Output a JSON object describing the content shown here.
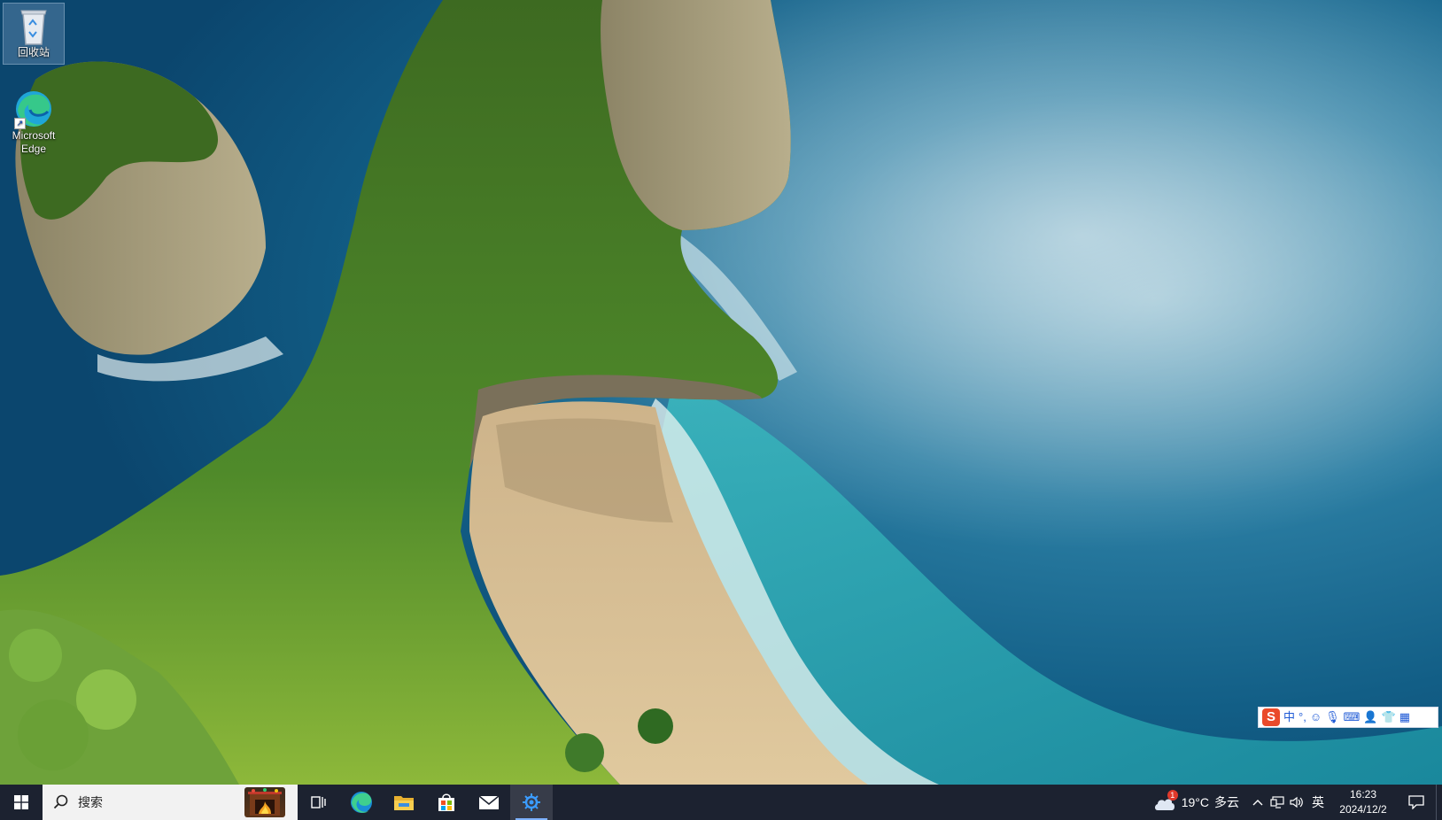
{
  "desktop": {
    "icons": [
      {
        "label": "回收站",
        "icon": "recycle-bin-icon"
      },
      {
        "label": "Microsoft Edge",
        "icon": "edge-icon"
      }
    ]
  },
  "ime_toolbar": {
    "logo": "S",
    "mode": "中",
    "items": [
      "punctuation-icon",
      "emoji-icon",
      "microphone-icon",
      "keyboard-icon",
      "user-icon",
      "skin-icon",
      "toolbox-icon"
    ]
  },
  "taskbar": {
    "search_placeholder": "搜索",
    "pinned": [
      "start-icon",
      "task-view-icon",
      "edge-icon",
      "file-explorer-icon",
      "store-icon",
      "mail-icon",
      "active-app-icon"
    ],
    "weather": {
      "badge": "1",
      "temperature": "19°C",
      "condition": "多云"
    },
    "input_language": "英",
    "clock": {
      "time": "16:23",
      "date": "2024/12/2"
    }
  },
  "colors": {
    "taskbar": "#1c2230",
    "accent": "#7eb2ff",
    "ime_logo": "#ea4a2a"
  }
}
